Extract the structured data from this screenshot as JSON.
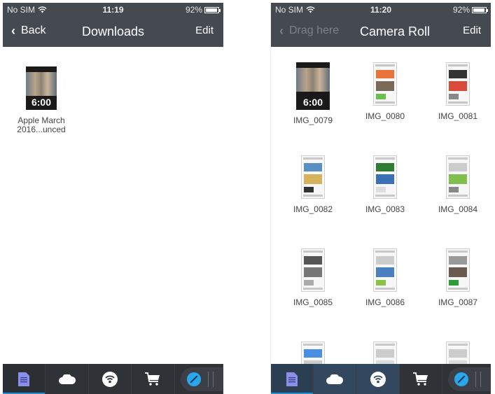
{
  "left_phone": {
    "status": {
      "carrier": "No SIM",
      "time": "11:19",
      "battery": "92%",
      "battery_level": 0.92
    },
    "nav": {
      "back_label": "Back",
      "title": "Downloads",
      "edit_label": "Edit"
    },
    "files": [
      {
        "name_line1": "Apple March",
        "name_line2": "2016...unced",
        "type": "video",
        "duration": "6:00"
      }
    ],
    "tabs": [
      {
        "icon": "document-icon",
        "active": true
      },
      {
        "icon": "cloud-icon"
      },
      {
        "icon": "wifi-icon"
      },
      {
        "icon": "cart-icon"
      },
      {
        "icon": "compass-icon"
      }
    ]
  },
  "right_phone": {
    "status": {
      "carrier": "No SIM",
      "time": "11:20",
      "battery": "92%",
      "battery_level": 0.92
    },
    "nav": {
      "back_label": "Drag here",
      "title": "Camera Roll",
      "edit_label": "Edit"
    },
    "files": [
      {
        "name": "IMG_0079",
        "type": "video",
        "duration": "6:00"
      },
      {
        "name": "IMG_0080",
        "type": "screenshot"
      },
      {
        "name": "IMG_0081",
        "type": "screenshot"
      },
      {
        "name": "IMG_0082",
        "type": "screenshot"
      },
      {
        "name": "IMG_0083",
        "type": "screenshot"
      },
      {
        "name": "IMG_0084",
        "type": "screenshot"
      },
      {
        "name": "IMG_0085",
        "type": "screenshot"
      },
      {
        "name": "IMG_0086",
        "type": "screenshot"
      },
      {
        "name": "IMG_0087",
        "type": "screenshot"
      },
      {
        "name": "",
        "type": "screenshot"
      },
      {
        "name": "",
        "type": "screenshot"
      },
      {
        "name": "",
        "type": "screenshot"
      }
    ],
    "tabs": [
      {
        "icon": "document-icon",
        "active": true
      },
      {
        "icon": "cloud-icon"
      },
      {
        "icon": "wifi-icon"
      },
      {
        "icon": "cart-icon"
      },
      {
        "icon": "compass-icon"
      }
    ]
  },
  "colors": {
    "header_bg": "#454950",
    "tabbar_bg": "#2f3237",
    "document_icon": "#8a8fe8",
    "compass_icon": "#2aa6ea",
    "drop_highlight": "#33475e"
  }
}
